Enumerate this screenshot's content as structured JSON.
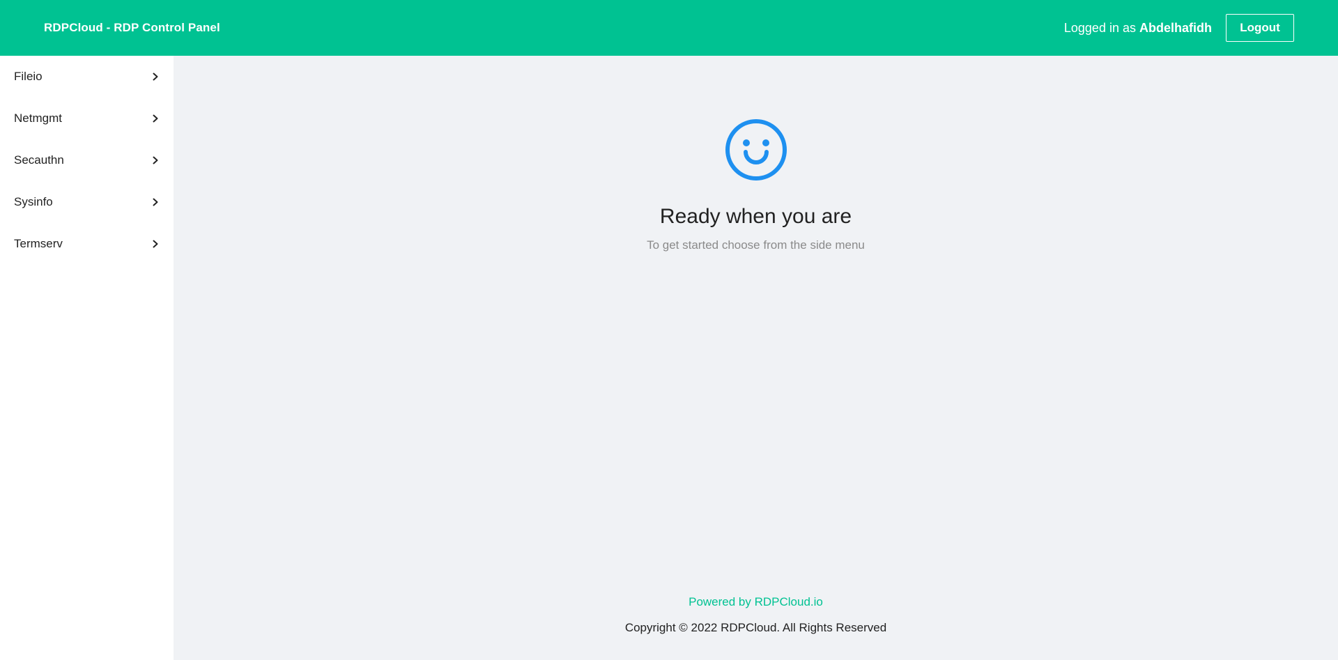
{
  "header": {
    "brand": "RDPCloud - RDP Control Panel",
    "logged_in_prefix": "Logged in as",
    "username": "Abdelhafidh",
    "logout_label": "Logout"
  },
  "sidebar": {
    "items": [
      {
        "label": "Fileio",
        "icon": "chevron-right-icon"
      },
      {
        "label": "Netmgmt",
        "icon": "chevron-right-icon"
      },
      {
        "label": "Secauthn",
        "icon": "chevron-right-icon"
      },
      {
        "label": "Sysinfo",
        "icon": "chevron-right-icon"
      },
      {
        "label": "Termserv",
        "icon": "chevron-right-icon"
      }
    ]
  },
  "main": {
    "icon": "smile-icon",
    "title": "Ready when you are",
    "subtitle": "To get started choose from the side menu"
  },
  "footer": {
    "powered_by": "Powered by RDPCloud.io",
    "copyright": "Copyright © 2022 RDPCloud. All Rights Reserved"
  },
  "colors": {
    "brand": "#00c292",
    "accent_icon": "#1e90f0",
    "background": "#f0f2f5",
    "sidebar_background": "#ffffff"
  }
}
